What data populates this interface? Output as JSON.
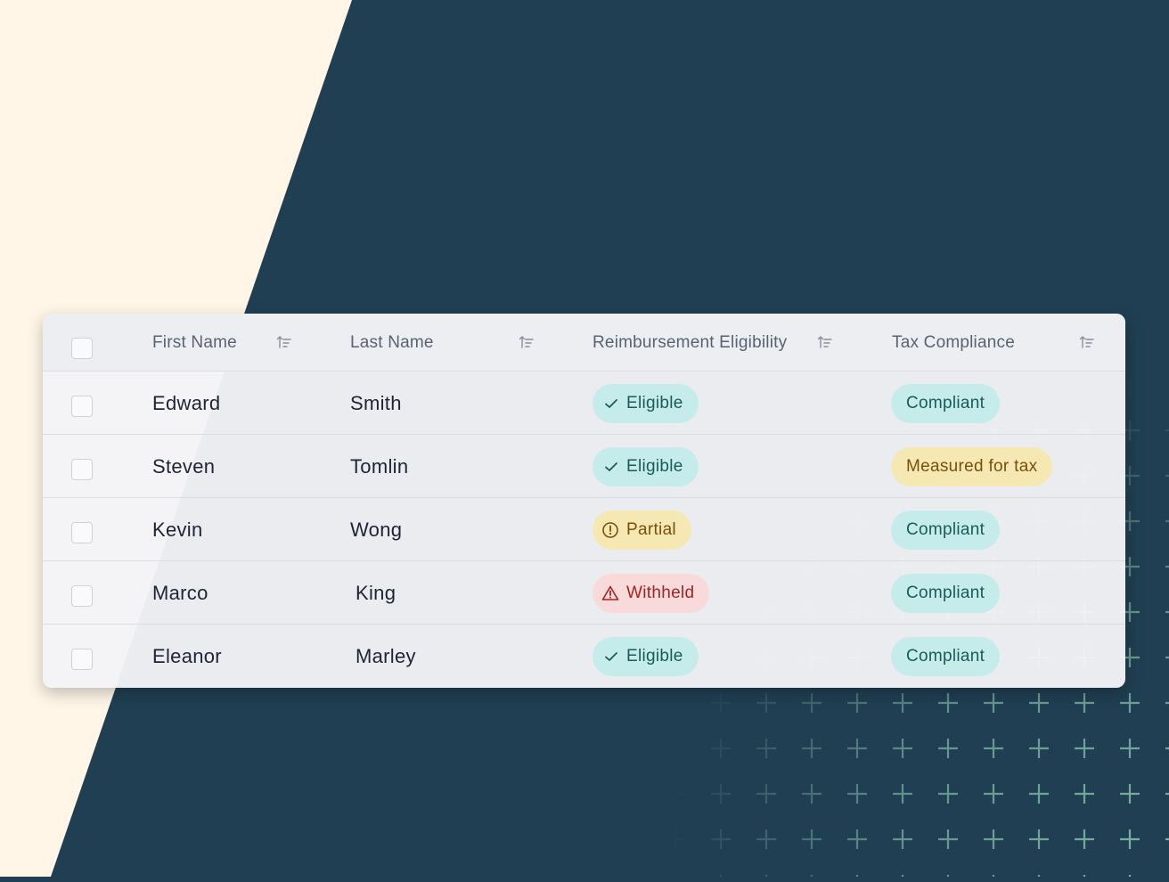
{
  "table": {
    "headers": {
      "first_name": "First Name",
      "last_name": "Last Name",
      "eligibility": "Reimbursement Eligibility",
      "tax": "Tax Compliance"
    },
    "rows": [
      {
        "first": "Edward",
        "last": "Smith",
        "eligibility": "Eligible",
        "eligibility_status": "eligible",
        "tax": "Compliant",
        "tax_status": "compliant"
      },
      {
        "first": "Steven",
        "last": "Tomlin",
        "eligibility": "Eligible",
        "eligibility_status": "eligible",
        "tax": "Measured for tax",
        "tax_status": "measured"
      },
      {
        "first": "Kevin",
        "last": "Wong",
        "eligibility": "Partial",
        "eligibility_status": "partial",
        "tax": "Compliant",
        "tax_status": "compliant"
      },
      {
        "first": "Marco",
        "last": "King",
        "eligibility": "Withheld",
        "eligibility_status": "withheld",
        "tax": "Compliant",
        "tax_status": "compliant"
      },
      {
        "first": "Eleanor",
        "last": "Marley",
        "eligibility": "Eligible",
        "eligibility_status": "eligible",
        "tax": "Compliant",
        "tax_status": "compliant"
      }
    ]
  },
  "icons": {
    "sort": "sort-ascending-icon",
    "eligible": "check-icon",
    "partial": "alert-circle-icon",
    "withheld": "warning-triangle-icon"
  },
  "colors": {
    "background_dark": "#203f52",
    "background_cream": "#fff6e8",
    "status_teal": "#c5ecea",
    "status_yellow": "#f5e8b3",
    "status_red": "#f8dada"
  }
}
